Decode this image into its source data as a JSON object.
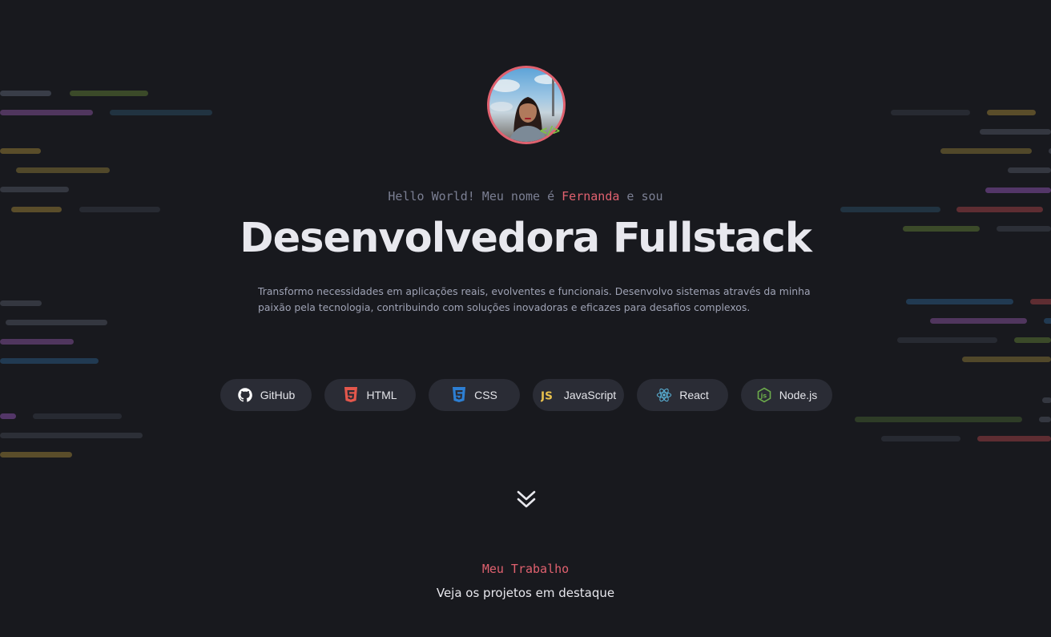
{
  "hero": {
    "greeting_prefix": "Hello World! Meu nome é ",
    "greeting_name": "Fernanda",
    "greeting_suffix": " e sou",
    "title": "Desenvolvedora Fullstack",
    "description": "Transformo necessidades em aplicações reais, evolventes e funcionais. Desenvolvo sistemas através da minha paixão pela tecnologia, contribuindo com soluções inovadoras e eficazes para desafios complexos.",
    "avatar_badge": "</>"
  },
  "techs": [
    {
      "label": "GitHub",
      "icon": "github-icon",
      "color": "#ffffff"
    },
    {
      "label": "HTML",
      "icon": "html5-icon",
      "color": "#e4574c"
    },
    {
      "label": "CSS",
      "icon": "css3-icon",
      "color": "#2d7fd3"
    },
    {
      "label": "JavaScript",
      "icon": "js-icon",
      "color": "#e9c14d"
    },
    {
      "label": "React",
      "icon": "react-icon",
      "color": "#5bb6dc"
    },
    {
      "label": "Node.js",
      "icon": "nodejs-icon",
      "color": "#6cab4b"
    }
  ],
  "section": {
    "kicker": "Meu Trabalho",
    "title": "Veja os projetos em destaque"
  },
  "colors": {
    "background": "#18191e",
    "accent": "#e0616f",
    "pill": "#2a2c35",
    "text": "#e8e8ee",
    "muted": "#7b7f93"
  }
}
